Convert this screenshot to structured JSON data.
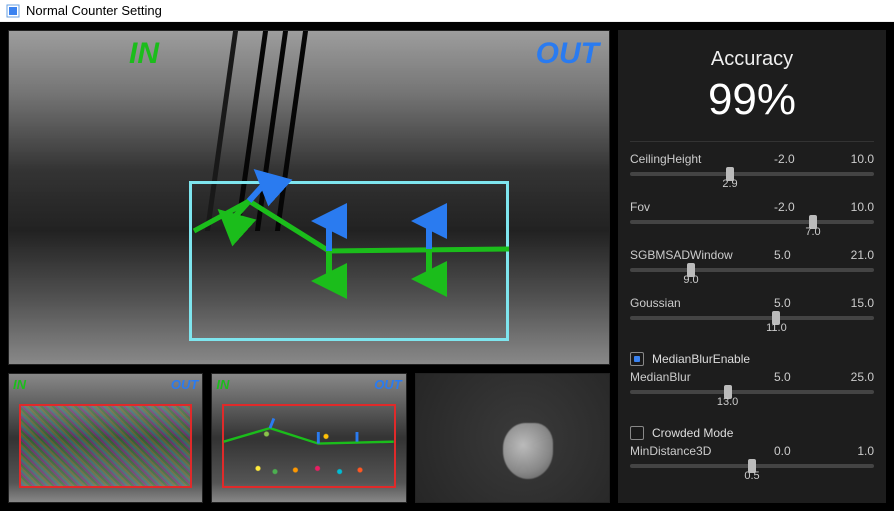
{
  "window": {
    "title": "Normal Counter Setting"
  },
  "views": {
    "in_label": "IN",
    "out_label": "OUT"
  },
  "accuracy": {
    "label": "Accuracy",
    "value": "99%"
  },
  "sliders": {
    "ceilingHeight": {
      "label": "CeilingHeight",
      "min": "-2.0",
      "max": "10.0",
      "value": "2.9"
    },
    "fov": {
      "label": "Fov",
      "min": "-2.0",
      "max": "10.0",
      "value": "7.0"
    },
    "sgbm": {
      "label": "SGBMSADWindow",
      "min": "5.0",
      "max": "21.0",
      "value": "9.0"
    },
    "gaussian": {
      "label": "Goussian",
      "min": "5.0",
      "max": "15.0",
      "value": "11.0"
    },
    "medianBlur": {
      "label": "MedianBlur",
      "min": "5.0",
      "max": "25.0",
      "value": "13.0"
    },
    "minDist3d": {
      "label": "MinDistance3D",
      "min": "0.0",
      "max": "1.0",
      "value": "0.5"
    }
  },
  "checkboxes": {
    "medianBlurEnable": {
      "label": "MedianBlurEnable",
      "checked": true
    },
    "crowdedMode": {
      "label": "Crowded Mode",
      "checked": false
    }
  }
}
